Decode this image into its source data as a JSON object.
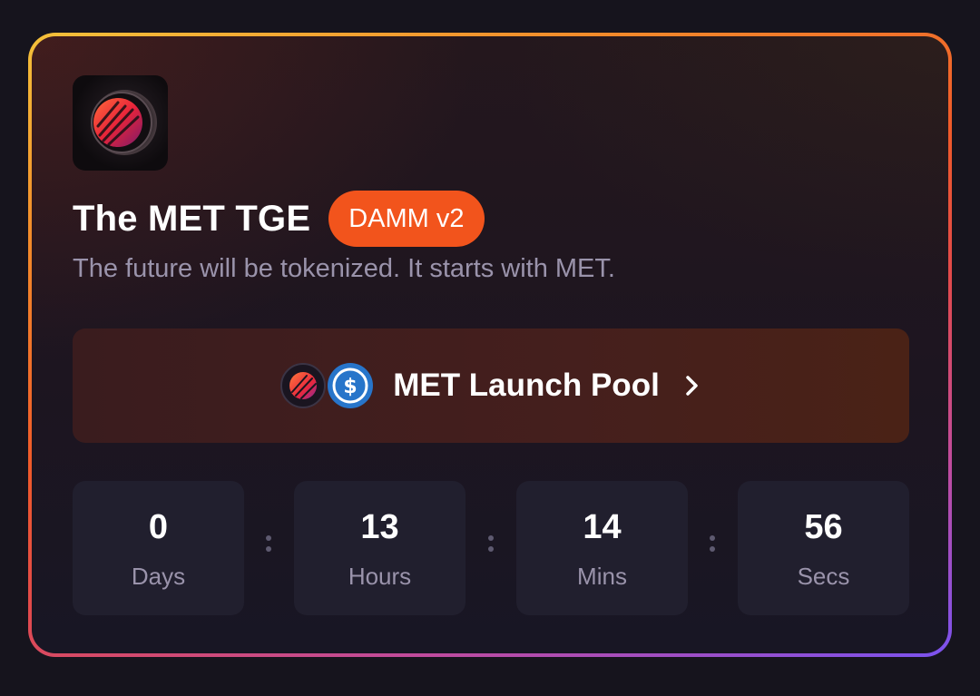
{
  "header": {
    "logo_icon": "met-logo-icon",
    "title": "The MET TGE",
    "badge": "DAMM v2",
    "subtitle": "The future will be tokenized. It starts with MET."
  },
  "pool": {
    "label": "MET Launch Pool",
    "token_icons": [
      "met-token-icon",
      "usdc-token-icon"
    ],
    "chevron_icon": "chevron-right-icon"
  },
  "countdown": {
    "days": {
      "value": "0",
      "label": "Days"
    },
    "hours": {
      "value": "13",
      "label": "Hours"
    },
    "mins": {
      "value": "14",
      "label": "Mins"
    },
    "secs": {
      "value": "56",
      "label": "Secs"
    }
  },
  "colors": {
    "badge": "#f2541c",
    "usdc": "#2775ca",
    "border_gradient": [
      "#f4c13a",
      "#ef5a2a",
      "#7a52f0"
    ]
  }
}
